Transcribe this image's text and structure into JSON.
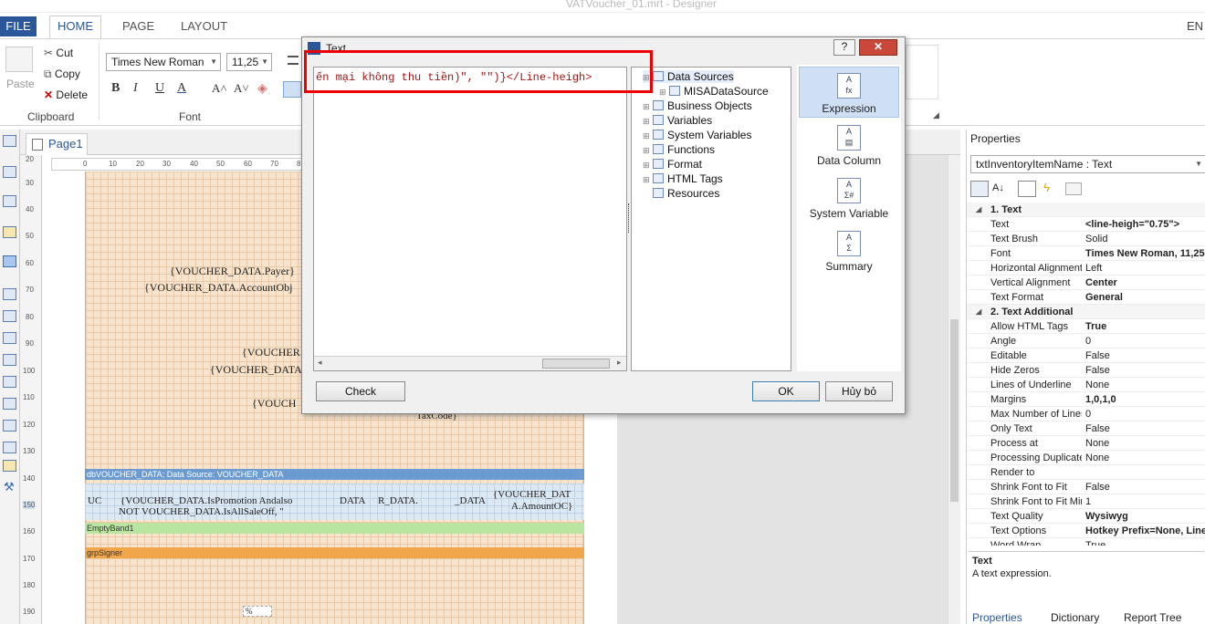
{
  "window": {
    "title": "VATVoucher_01.mrt - Designer",
    "lang": "EN"
  },
  "ribbon": {
    "tabs": [
      "FILE",
      "HOME",
      "PAGE",
      "LAYOUT"
    ],
    "paste_label": "Paste",
    "cut_label": "Cut",
    "copy_label": "Copy",
    "delete_label": "Delete",
    "clipboard_group": "Clipboard",
    "font_group": "Font",
    "font_name": "Times New Roman",
    "font_size": "11,25"
  },
  "page_tab": "Page1",
  "ruler": {
    "top": [
      "0",
      "10",
      "20",
      "30",
      "40",
      "50",
      "60",
      "70",
      "8"
    ],
    "left": [
      "20",
      "30",
      "40",
      "50",
      "60",
      "70",
      "80",
      "90",
      "100",
      "110",
      "120",
      "130",
      "140",
      "150",
      "160",
      "170",
      "180",
      "190"
    ]
  },
  "report": {
    "fields": [
      "{VOUCHER_DATA.Payer}",
      "{VOUCHER_DATA.AccountObj",
      "{VOUCHER",
      "{VOUCHER_DATA",
      "{VOUCH",
      "TaxCode}"
    ],
    "band_data": "dbVOUCHER_DATA; Data Source: VOUCHER_DATA",
    "row_cells": [
      "UC",
      "{VOUCHER_DATA.IsPromotion Andalso",
      "NOT VOUCHER_DATA.IsAllSaleOff, \"",
      "DATA",
      "R_DATA.",
      "_DATA",
      "{VOUCHER_DAT",
      "A.AmountOC}"
    ],
    "band_empty": "EmptyBand1",
    "band_signer": "grpSigner",
    "percent": "%"
  },
  "dialog": {
    "title": "Text",
    "expression_text": "ến mại không thu tiền)\", \"\")}</Line-heigh>",
    "tree": [
      {
        "label": "Data Sources",
        "level": 0,
        "icon": "database-icon"
      },
      {
        "label": "MISADataSource",
        "level": 1,
        "icon": "datasource-icon"
      },
      {
        "label": "Business Objects",
        "level": 0,
        "icon": "business-objects-icon"
      },
      {
        "label": "Variables",
        "level": 0,
        "icon": "variables-icon"
      },
      {
        "label": "System Variables",
        "level": 0,
        "icon": "system-variables-icon"
      },
      {
        "label": "Functions",
        "level": 0,
        "icon": "function-icon"
      },
      {
        "label": "Format",
        "level": 0,
        "icon": "format-icon"
      },
      {
        "label": "HTML Tags",
        "level": 0,
        "icon": "html-icon"
      },
      {
        "label": "Resources",
        "level": 0,
        "icon": "resources-icon"
      }
    ],
    "side_buttons": [
      "Expression",
      "Data Column",
      "System Variable",
      "Summary"
    ],
    "check_label": "Check",
    "ok_label": "OK",
    "cancel_label": "Hủy bỏ"
  },
  "properties": {
    "header": "Properties",
    "selector": "txtInventoryItemName : Text",
    "rows": [
      {
        "name": "1. Text",
        "value": "",
        "cat": true
      },
      {
        "name": "Text",
        "value": "<line-heigh=\"0.75\">",
        "cat": false
      },
      {
        "name": "Text Brush",
        "value": "Solid",
        "cat": false
      },
      {
        "name": "Font",
        "value": "Times New Roman, 11,25",
        "cat": false
      },
      {
        "name": "Horizontal Alignment",
        "value": "Left",
        "cat": false
      },
      {
        "name": "Vertical Alignment",
        "value": "Center",
        "cat": false
      },
      {
        "name": "Text Format",
        "value": "General",
        "cat": false
      },
      {
        "name": "2. Text  Additional",
        "value": "",
        "cat": true
      },
      {
        "name": "Allow HTML Tags",
        "value": "True",
        "cat": false
      },
      {
        "name": "Angle",
        "value": "0",
        "cat": false
      },
      {
        "name": "Editable",
        "value": "False",
        "cat": false
      },
      {
        "name": "Hide Zeros",
        "value": "False",
        "cat": false
      },
      {
        "name": "Lines of Underline",
        "value": "None",
        "cat": false
      },
      {
        "name": "Margins",
        "value": "1,0,1,0",
        "cat": false
      },
      {
        "name": "Max Number of Lines",
        "value": "0",
        "cat": false
      },
      {
        "name": "Only Text",
        "value": "False",
        "cat": false
      },
      {
        "name": "Process at",
        "value": "None",
        "cat": false
      },
      {
        "name": "Processing Duplicates",
        "value": "None",
        "cat": false
      },
      {
        "name": "Render to",
        "value": "",
        "cat": false
      },
      {
        "name": "Shrink Font to Fit",
        "value": "False",
        "cat": false
      },
      {
        "name": "Shrink Font to Fit Min",
        "value": "1",
        "cat": false
      },
      {
        "name": "Text Quality",
        "value": "Wysiwyg",
        "cat": false
      },
      {
        "name": "Text Options",
        "value": "Hotkey Prefix=None, Line",
        "cat": false
      },
      {
        "name": "Word Wrap",
        "value": "True",
        "cat": false
      }
    ],
    "desc_title": "Text",
    "desc_text": "A text expression.",
    "bottom_tabs": [
      "Properties",
      "Dictionary",
      "Report Tree"
    ]
  },
  "colors": {
    "accent": "#2b579a",
    "highlight": "#e00000",
    "band_data": "#6b9bd1",
    "band_empty": "#b8e6a0",
    "band_signer": "#f2a64a"
  }
}
